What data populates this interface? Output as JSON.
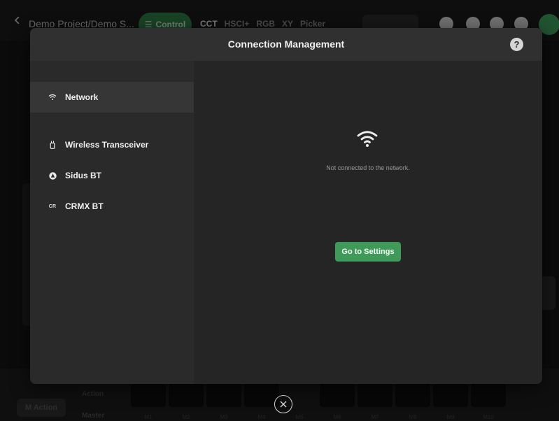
{
  "app": {
    "project_title": "Demo Project/Demo S...",
    "control_label": "Control",
    "mode_tabs": [
      "CCT",
      "HSCI+",
      "RGB",
      "XY",
      "Picker"
    ],
    "bottom": {
      "m_action_label": "M Action",
      "action_label": "Action",
      "master_label": "Master",
      "memory_slots": [
        "M1",
        "M2",
        "M3",
        "M4",
        "M5",
        "M6",
        "M7",
        "M8",
        "M9",
        "M10"
      ]
    }
  },
  "modal": {
    "title": "Connection Management",
    "help_label": "?",
    "sidebar": [
      {
        "label": "Network",
        "icon": "wifi-icon",
        "active": true
      },
      {
        "label": "Wireless Transceiver",
        "icon": "transceiver-icon",
        "active": false
      },
      {
        "label": "Sidus BT",
        "icon": "sidus-bt-icon",
        "active": false
      },
      {
        "label": "CRMX BT",
        "icon": "crmx-icon",
        "icon_text": "CR",
        "active": false
      }
    ],
    "content": {
      "status_text": "Not connected to the network.",
      "button_label": "Go to Settings"
    }
  },
  "colors": {
    "accent_green": "#3f9a5a",
    "modal_bg": "#252525",
    "sidebar_bg": "#2a2a2a",
    "active_item_bg": "#363636"
  }
}
